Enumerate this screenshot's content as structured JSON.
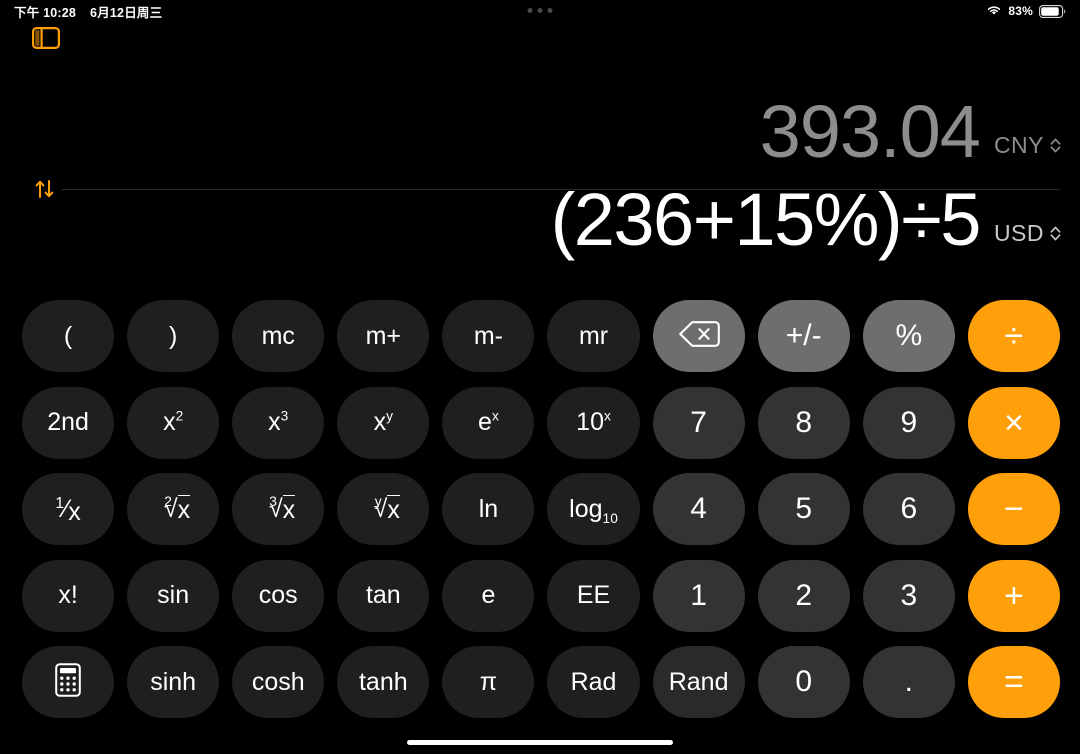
{
  "status_bar": {
    "time": "下午 10:28",
    "date": "6月12日周三",
    "battery_percent": "83%",
    "wifi_icon": "wifi-icon",
    "battery_icon": "battery-icon",
    "multitask_icon": "multitask-dots-icon"
  },
  "sidebar_toggle": {
    "icon": "sidebar-toggle-icon",
    "accent": "#ff9f0a"
  },
  "display": {
    "secondary_value": "393.04",
    "secondary_currency": "CNY",
    "primary_expression": "(236+15%)÷5",
    "primary_currency": "USD",
    "swap_icon": "swap-arrows-icon",
    "chevron_icon": "chevron-up-down-icon"
  },
  "colors": {
    "accent": "#ff9f0a",
    "function_key": "#1f1f1f",
    "function_key_light": "#2a2a2a",
    "digit_key": "#333333",
    "utility_key": "#6e6e6e",
    "background": "#000000",
    "primary_text": "#ffffff",
    "secondary_text": "#8d8d8d"
  },
  "keypad": {
    "rows": [
      [
        {
          "name": "open-paren",
          "label": "(",
          "style": "fn"
        },
        {
          "name": "close-paren",
          "label": ")",
          "style": "fn"
        },
        {
          "name": "mc",
          "label": "mc",
          "style": "fn"
        },
        {
          "name": "m-plus",
          "label": "m+",
          "style": "fn"
        },
        {
          "name": "m-minus",
          "label": "m-",
          "style": "fn"
        },
        {
          "name": "mr",
          "label": "mr",
          "style": "fn"
        },
        {
          "name": "delete",
          "label": "",
          "style": "util",
          "icon": "backspace-delete-icon"
        },
        {
          "name": "sign-toggle",
          "label": "+/-",
          "style": "util"
        },
        {
          "name": "percent",
          "label": "%",
          "style": "util"
        },
        {
          "name": "divide",
          "label": "÷",
          "style": "accent"
        }
      ],
      [
        {
          "name": "second-fn",
          "label": "2nd",
          "style": "fn"
        },
        {
          "name": "x-squared",
          "label": "x²",
          "style": "fn"
        },
        {
          "name": "x-cubed",
          "label": "x³",
          "style": "fn"
        },
        {
          "name": "x-power-y",
          "label": "xʸ",
          "style": "fn"
        },
        {
          "name": "e-power-x",
          "label": "eˣ",
          "style": "fn"
        },
        {
          "name": "ten-power-x",
          "label": "10ˣ",
          "style": "fn"
        },
        {
          "name": "digit-7",
          "label": "7",
          "style": "digit"
        },
        {
          "name": "digit-8",
          "label": "8",
          "style": "digit"
        },
        {
          "name": "digit-9",
          "label": "9",
          "style": "digit"
        },
        {
          "name": "multiply",
          "label": "×",
          "style": "accent"
        }
      ],
      [
        {
          "name": "reciprocal",
          "label": "1/x",
          "style": "fn"
        },
        {
          "name": "square-root",
          "label": "²√x",
          "style": "fn"
        },
        {
          "name": "cube-root",
          "label": "³√x",
          "style": "fn"
        },
        {
          "name": "y-root",
          "label": "ʸ√x",
          "style": "fn"
        },
        {
          "name": "natural-log",
          "label": "ln",
          "style": "fn"
        },
        {
          "name": "log-base-10",
          "label": "log10",
          "style": "fn"
        },
        {
          "name": "digit-4",
          "label": "4",
          "style": "digit"
        },
        {
          "name": "digit-5",
          "label": "5",
          "style": "digit"
        },
        {
          "name": "digit-6",
          "label": "6",
          "style": "digit"
        },
        {
          "name": "subtract",
          "label": "−",
          "style": "accent"
        }
      ],
      [
        {
          "name": "factorial",
          "label": "x!",
          "style": "fn"
        },
        {
          "name": "sin",
          "label": "sin",
          "style": "fn"
        },
        {
          "name": "cos",
          "label": "cos",
          "style": "fn"
        },
        {
          "name": "tan",
          "label": "tan",
          "style": "fn"
        },
        {
          "name": "euler-e",
          "label": "e",
          "style": "fn"
        },
        {
          "name": "ee",
          "label": "EE",
          "style": "fn"
        },
        {
          "name": "digit-1",
          "label": "1",
          "style": "digit"
        },
        {
          "name": "digit-2",
          "label": "2",
          "style": "digit"
        },
        {
          "name": "digit-3",
          "label": "3",
          "style": "digit"
        },
        {
          "name": "add",
          "label": "+",
          "style": "accent"
        }
      ],
      [
        {
          "name": "calculator-mode",
          "label": "",
          "style": "fn",
          "icon": "calculator-icon"
        },
        {
          "name": "sinh",
          "label": "sinh",
          "style": "fn"
        },
        {
          "name": "cosh",
          "label": "cosh",
          "style": "fn"
        },
        {
          "name": "tanh",
          "label": "tanh",
          "style": "fn"
        },
        {
          "name": "pi",
          "label": "π",
          "style": "fn"
        },
        {
          "name": "rad",
          "label": "Rad",
          "style": "fn"
        },
        {
          "name": "rand",
          "label": "Rand",
          "style": "fn-lite"
        },
        {
          "name": "digit-0",
          "label": "0",
          "style": "digit"
        },
        {
          "name": "decimal",
          "label": ".",
          "style": "digit"
        },
        {
          "name": "equals",
          "label": "=",
          "style": "accent"
        }
      ]
    ]
  },
  "home_indicator": {
    "name": "home-indicator"
  }
}
